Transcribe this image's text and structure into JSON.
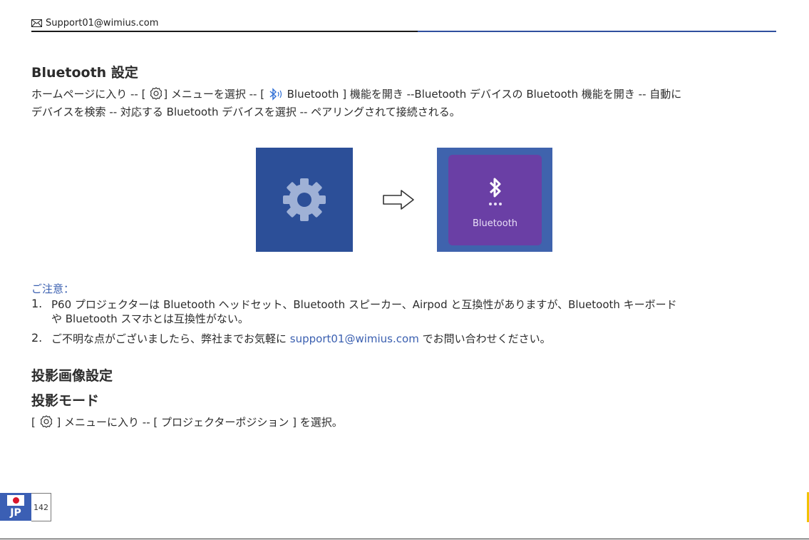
{
  "header": {
    "email": "Support01@wimius.com",
    "icon": "mail-icon"
  },
  "section1": {
    "title": "Bluetooth 設定",
    "line1_a": "ホームページに入り --  [ ",
    "line1_b": "] メニューを選択 -- [ ",
    "line1_c": " Bluetooth ] 機能を開き --Bluetooth デバイスの Bluetooth 機能を開き -- 自動に",
    "line2": "デバイスを検索 -- 対応する Bluetooth デバイスを選択  -- ペアリングされて接続される。"
  },
  "images": {
    "bt_label": "Bluetooth",
    "arrow": "arrow-right-icon"
  },
  "notes": {
    "title": "ご注意：",
    "item1_num": "1.",
    "item1_line1": "P60 プロジェクターは Bluetooth ヘッドセット、Bluetooth スピーカー、Airpod と互換性がありますが、Bluetooth キーボード",
    "item1_line2": "や Bluetooth スマホとは互換性がない。",
    "item2_num": "2.",
    "item2_a": "ご不明な点がございましたら、弊社までお気軽に ",
    "item2_link": "support01@wimius.com",
    "item2_b": " でお問い合わせください。"
  },
  "section2": {
    "title": "投影画像設定",
    "subtitle": "投影モード",
    "line_a": "[ ",
    "line_b": " ] メニューに入り --  [ プロジェクターポジション ] を選択。"
  },
  "footer": {
    "country": "JP",
    "page": "142"
  },
  "colors": {
    "accent": "#3a5fb0",
    "settings_bg": "#2c4f98",
    "bt_tile": "#6a3fa5"
  }
}
